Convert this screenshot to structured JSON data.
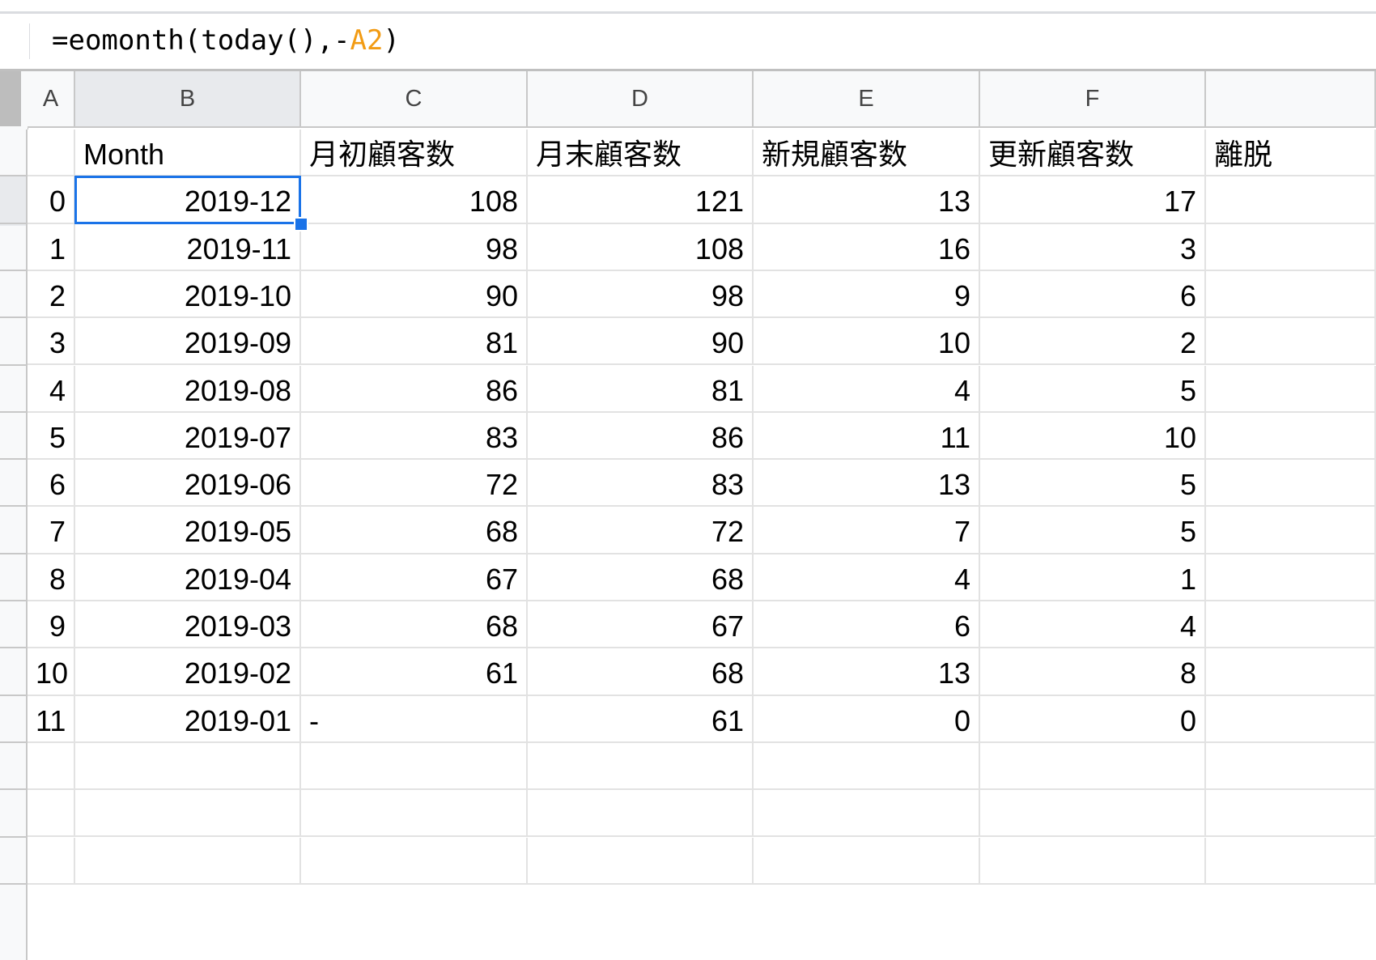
{
  "formula_bar": {
    "prefix": "=eomonth(today(),-",
    "ref": "A2",
    "suffix": ")"
  },
  "columns": [
    "A",
    "B",
    "C",
    "D",
    "E",
    "F",
    ""
  ],
  "selected_column": "B",
  "headers": [
    "",
    "Month",
    "月初顧客数",
    "月末顧客数",
    "新規顧客数",
    "更新顧客数",
    "離脱"
  ],
  "rows": [
    [
      "0",
      "2019-12",
      "108",
      "121",
      "13",
      "17"
    ],
    [
      "1",
      "2019-11",
      "98",
      "108",
      "16",
      "3"
    ],
    [
      "2",
      "2019-10",
      "90",
      "98",
      "9",
      "6"
    ],
    [
      "3",
      "2019-09",
      "81",
      "90",
      "10",
      "2"
    ],
    [
      "4",
      "2019-08",
      "86",
      "81",
      "4",
      "5"
    ],
    [
      "5",
      "2019-07",
      "83",
      "86",
      "11",
      "10"
    ],
    [
      "6",
      "2019-06",
      "72",
      "83",
      "13",
      "5"
    ],
    [
      "7",
      "2019-05",
      "68",
      "72",
      "7",
      "5"
    ],
    [
      "8",
      "2019-04",
      "67",
      "68",
      "4",
      "1"
    ],
    [
      "9",
      "2019-03",
      "68",
      "67",
      "6",
      "4"
    ],
    [
      "10",
      "2019-02",
      "61",
      "68",
      "13",
      "8"
    ],
    [
      "11",
      "2019-01",
      "-",
      "61",
      "0",
      "0"
    ]
  ],
  "empty_rows": 3,
  "selected_cell": {
    "row": 0,
    "col": 1
  },
  "colors": {
    "selection": "#1a73e8",
    "formula_reference": "#f29b13",
    "header_bg": "#f8f9fa"
  }
}
